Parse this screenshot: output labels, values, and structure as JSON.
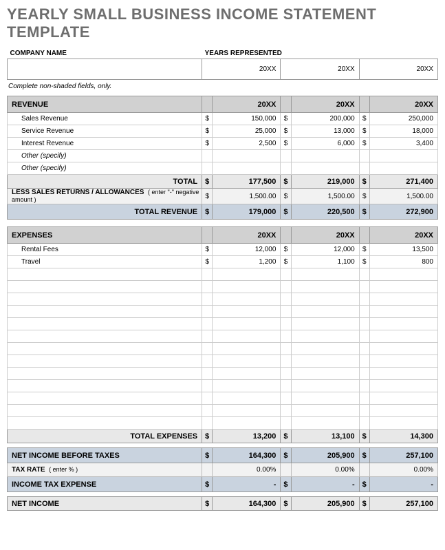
{
  "title": "YEARLY SMALL BUSINESS INCOME STATEMENT TEMPLATE",
  "labels": {
    "company_name": "COMPANY NAME",
    "years_represented": "YEARS REPRESENTED",
    "note": "Complete non-shaded fields, only.",
    "revenue": "REVENUE",
    "total": "TOTAL",
    "less_returns": "LESS SALES RETURNS / ALLOWANCES",
    "less_returns_hint": "( enter \"-\" negative amount )",
    "total_revenue": "TOTAL REVENUE",
    "expenses": "EXPENSES",
    "total_expenses": "TOTAL EXPENSES",
    "net_before": "NET INCOME BEFORE TAXES",
    "tax_rate": "TAX RATE",
    "tax_rate_hint": "( enter % )",
    "income_tax_expense": "INCOME TAX EXPENSE",
    "net_income": "NET INCOME"
  },
  "years": {
    "y1": "20XX",
    "y2": "20XX",
    "y3": "20XX"
  },
  "revenue_rows": [
    {
      "name": "Sales Revenue",
      "v1": "150,000",
      "v2": "200,000",
      "v3": "250,000"
    },
    {
      "name": "Service Revenue",
      "v1": "25,000",
      "v2": "13,000",
      "v3": "18,000"
    },
    {
      "name": "Interest Revenue",
      "v1": "2,500",
      "v2": "6,000",
      "v3": "3,400"
    },
    {
      "name": "Other (specify)",
      "italic": true
    },
    {
      "name": "Other (specify)",
      "italic": true
    }
  ],
  "revenue_total": {
    "v1": "177,500",
    "v2": "219,000",
    "v3": "271,400"
  },
  "less_returns": {
    "v1": "1,500.00",
    "v2": "1,500.00",
    "v3": "1,500.00"
  },
  "total_revenue": {
    "v1": "179,000",
    "v2": "220,500",
    "v3": "272,900"
  },
  "expense_rows": [
    {
      "name": "Rental Fees",
      "v1": "12,000",
      "v2": "12,000",
      "v3": "13,500"
    },
    {
      "name": "Travel",
      "v1": "1,200",
      "v2": "1,100",
      "v3": "800"
    }
  ],
  "blank_expense_rows": 13,
  "total_expenses": {
    "v1": "13,200",
    "v2": "13,100",
    "v3": "14,300"
  },
  "net_before": {
    "v1": "164,300",
    "v2": "205,900",
    "v3": "257,100"
  },
  "tax_rate": {
    "v1": "0.00%",
    "v2": "0.00%",
    "v3": "0.00%"
  },
  "tax_expense": {
    "v1": "-",
    "v2": "-",
    "v3": "-"
  },
  "net_income": {
    "v1": "164,300",
    "v2": "205,900",
    "v3": "257,100"
  },
  "currency": "$"
}
